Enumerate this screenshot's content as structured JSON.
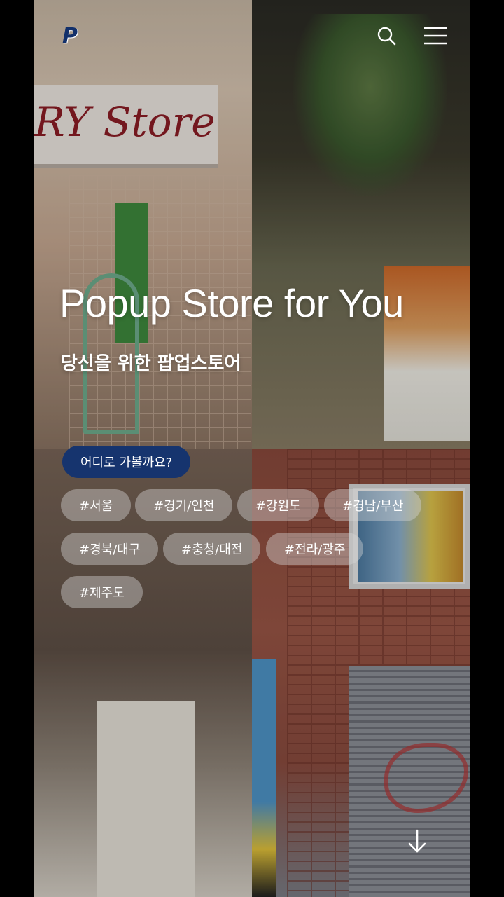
{
  "header": {
    "logo_text": "P",
    "icons": {
      "search": "search-icon",
      "menu": "hamburger-menu-icon"
    }
  },
  "hero": {
    "title": "Popup Store for You",
    "subtitle": "당신을 위한 팝업스토어"
  },
  "background": {
    "sign_text": "RY Store"
  },
  "region": {
    "prompt_label": "어디로 가볼까요?",
    "tags": [
      "#서울",
      "#경기/인천",
      "#강원도",
      "#경남/부산",
      "#경북/대구",
      "#충청/대전",
      "#전라/광주",
      "#제주도"
    ]
  },
  "scroll": {
    "icon": "arrow-down-icon"
  },
  "colors": {
    "brand_navy": "#16346e",
    "logo_blue": "#12306b",
    "chip_bg": "rgba(215,215,215,0.42)",
    "text_white": "#ffffff"
  }
}
